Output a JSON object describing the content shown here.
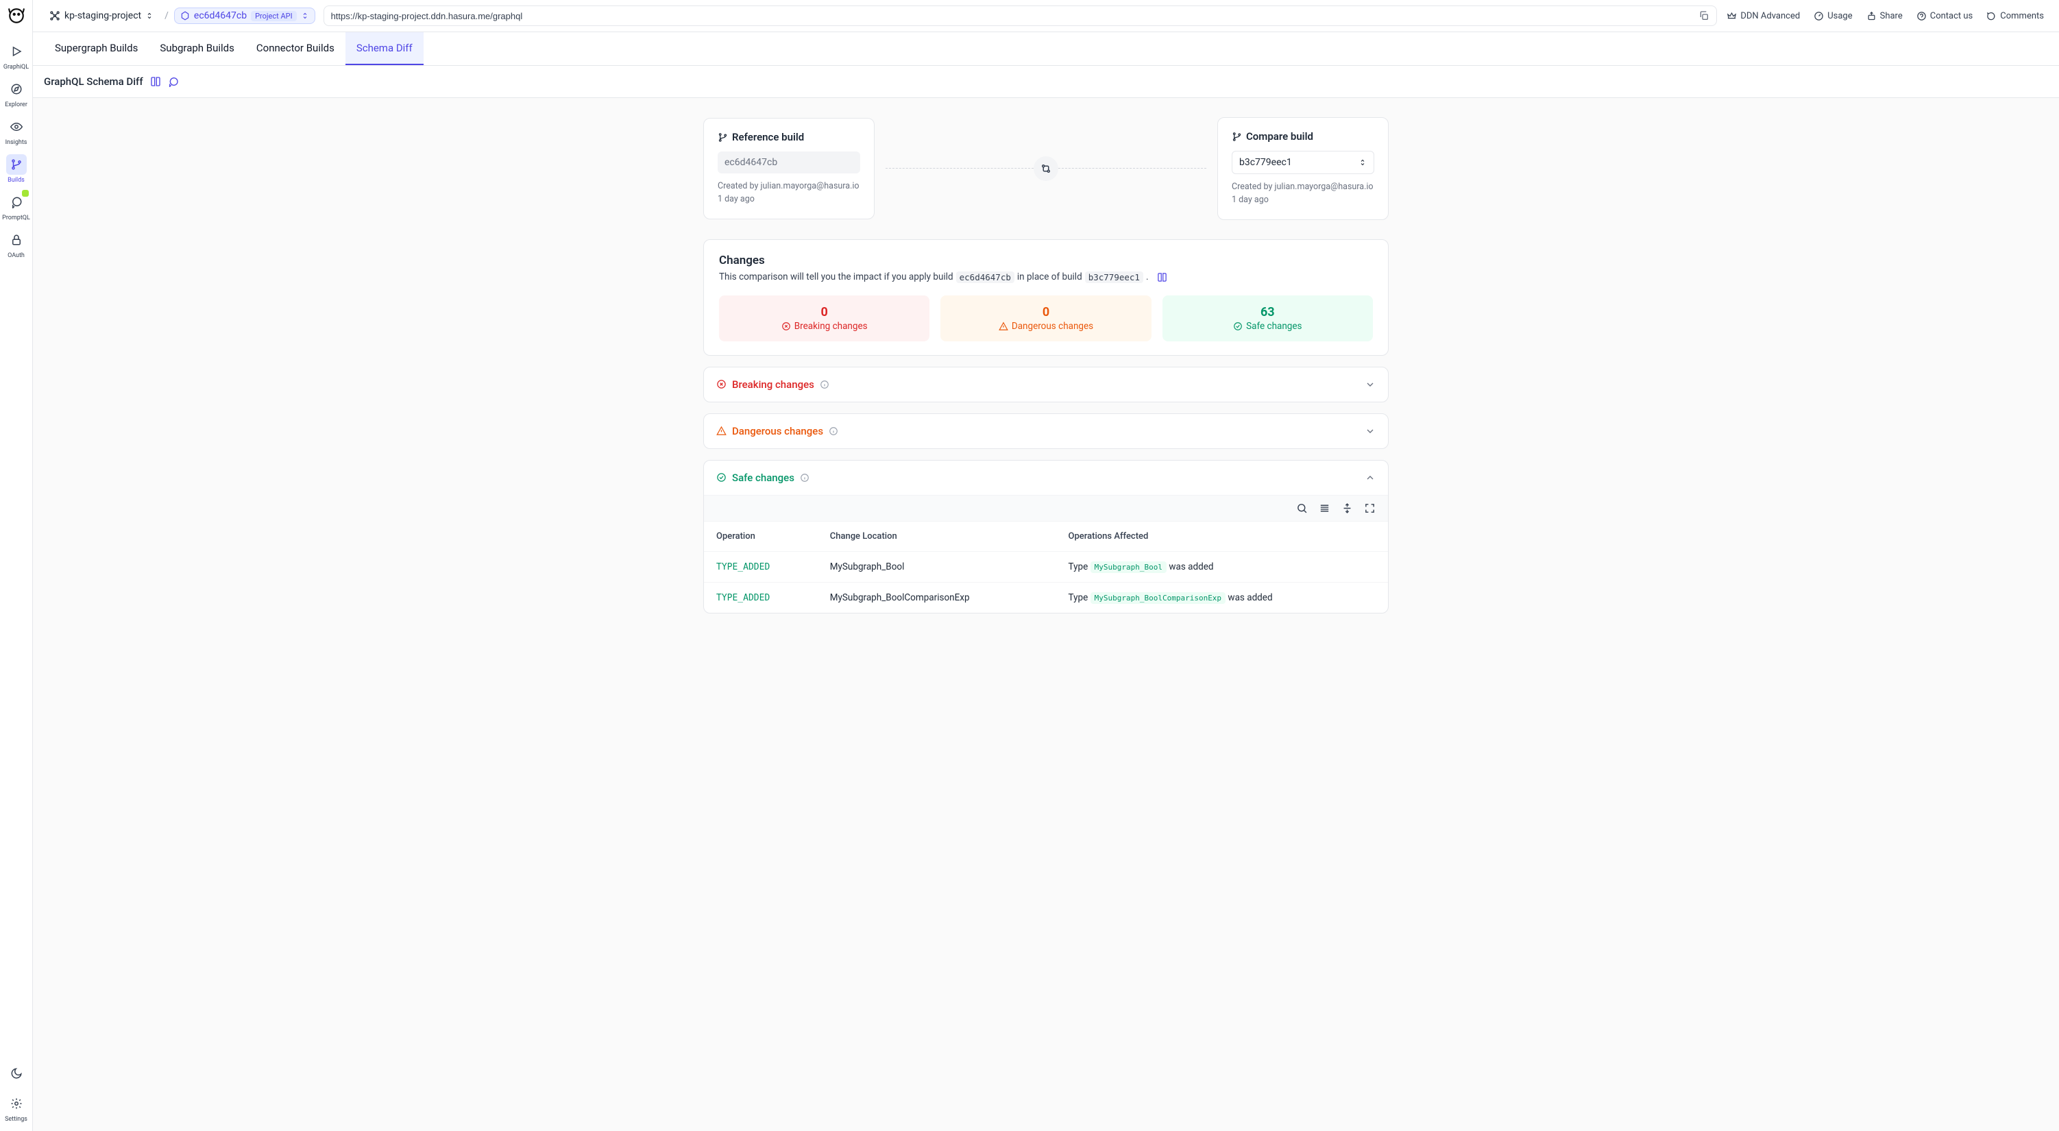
{
  "sidebar": {
    "items": [
      {
        "label": "GraphiQL"
      },
      {
        "label": "Explorer"
      },
      {
        "label": "Insights"
      },
      {
        "label": "Builds"
      },
      {
        "label": "PromptQL"
      },
      {
        "label": "OAuth"
      }
    ],
    "bottom": [
      {
        "label": ""
      },
      {
        "label": "Settings"
      }
    ]
  },
  "topbar": {
    "project": "kp-staging-project",
    "build_id": "ec6d4647cb",
    "api_pill": "Project API",
    "url": "https://kp-staging-project.ddn.hasura.me/graphql",
    "links": {
      "ddn": "DDN Advanced",
      "usage": "Usage",
      "share": "Share",
      "contact": "Contact us",
      "comments": "Comments"
    }
  },
  "tabs": [
    {
      "label": "Supergraph Builds"
    },
    {
      "label": "Subgraph Builds"
    },
    {
      "label": "Connector Builds"
    },
    {
      "label": "Schema Diff"
    }
  ],
  "subheader": {
    "title": "GraphQL Schema Diff"
  },
  "reference": {
    "title": "Reference build",
    "value": "ec6d4647cb",
    "created_by": "Created by julian.mayorga@hasura.io",
    "when": "1 day ago"
  },
  "compare": {
    "title": "Compare build",
    "value": "b3c779eec1",
    "created_by": "Created by julian.mayorga@hasura.io",
    "when": "1 day ago"
  },
  "changes": {
    "title": "Changes",
    "desc_pre": "This comparison will tell you the impact if you apply build",
    "desc_mid": "in place of build",
    "build_a": "ec6d4647cb",
    "build_b": "b3c779eec1",
    "dot": ".",
    "stats": {
      "breaking": {
        "count": "0",
        "label": "Breaking changes"
      },
      "dangerous": {
        "count": "0",
        "label": "Dangerous changes"
      },
      "safe": {
        "count": "63",
        "label": "Safe changes"
      }
    }
  },
  "sections": {
    "breaking": "Breaking changes",
    "dangerous": "Dangerous changes",
    "safe": "Safe changes"
  },
  "table": {
    "headers": {
      "op": "Operation",
      "loc": "Change Location",
      "aff": "Operations Affected"
    },
    "rows": [
      {
        "op": "TYPE_ADDED",
        "loc": "MySubgraph_Bool",
        "aff_pre": "Type",
        "aff_pill": "MySubgraph_Bool",
        "aff_post": "was added"
      },
      {
        "op": "TYPE_ADDED",
        "loc": "MySubgraph_BoolComparisonExp",
        "aff_pre": "Type",
        "aff_pill": "MySubgraph_BoolComparisonExp",
        "aff_post": "was added"
      }
    ]
  }
}
